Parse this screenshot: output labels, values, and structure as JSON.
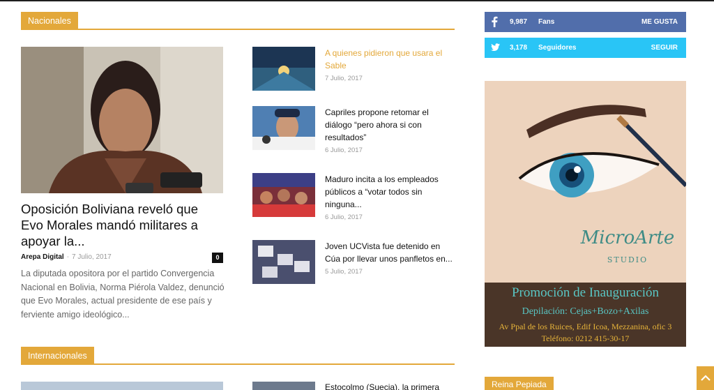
{
  "sections": {
    "nacionales": "Nacionales",
    "internacionales": "Internacionales"
  },
  "main_article": {
    "title": "Oposición Boliviana reveló que Evo Morales mandó militares a apoyar la...",
    "author": "Arepa Digital",
    "separator": "-",
    "date": "7 Julio, 2017",
    "comments": "0",
    "excerpt": "La diputada opositora por el partido Convergencia Nacional en Bolivia, Norma Piérola Valdez, denunció que Evo Morales, actual presidente de ese país y ferviente amigo ideológico..."
  },
  "side_articles": [
    {
      "title": "A quienes pidieron que usara el Sable",
      "date": "7 Julio, 2017"
    },
    {
      "title": "Capriles propone retomar el diálogo “pero ahora si con resultados”",
      "date": "6 Julio, 2017"
    },
    {
      "title": "Maduro incita a los empleados públicos a “votar todos sin ninguna...",
      "date": "6 Julio, 2017"
    },
    {
      "title": "Joven UCVista fue detenido en Cúa por llevar unos panfletos en...",
      "date": "5 Julio, 2017"
    }
  ],
  "social": {
    "facebook": {
      "count": "9,987",
      "label": "Fans",
      "action": "ME GUSTA",
      "color": "#516eab"
    },
    "twitter": {
      "count": "3,178",
      "label": "Seguidores",
      "action": "SEGUIR",
      "color": "#29c5f6"
    }
  },
  "ad": {
    "brand": "MicroArte",
    "studio": "STUDIO",
    "promo": "Promoción de Inauguración",
    "services": "Depilación: Cejas+Bozo+Axilas",
    "address": "Av Ppal de los Ruices, Edif Icoa, Mezzanina, ofic 3",
    "phone": "Teléfono: 0212 415-30-17"
  },
  "sidebar_section": "Reina Pepiada",
  "bottom_article_title": "Estocolmo (Suecia), la primera",
  "colors": {
    "accent": "#e3a83a",
    "link_highlight": "#e3a83a"
  },
  "icons": [
    "facebook-icon",
    "twitter-icon",
    "chevron-up-icon"
  ]
}
